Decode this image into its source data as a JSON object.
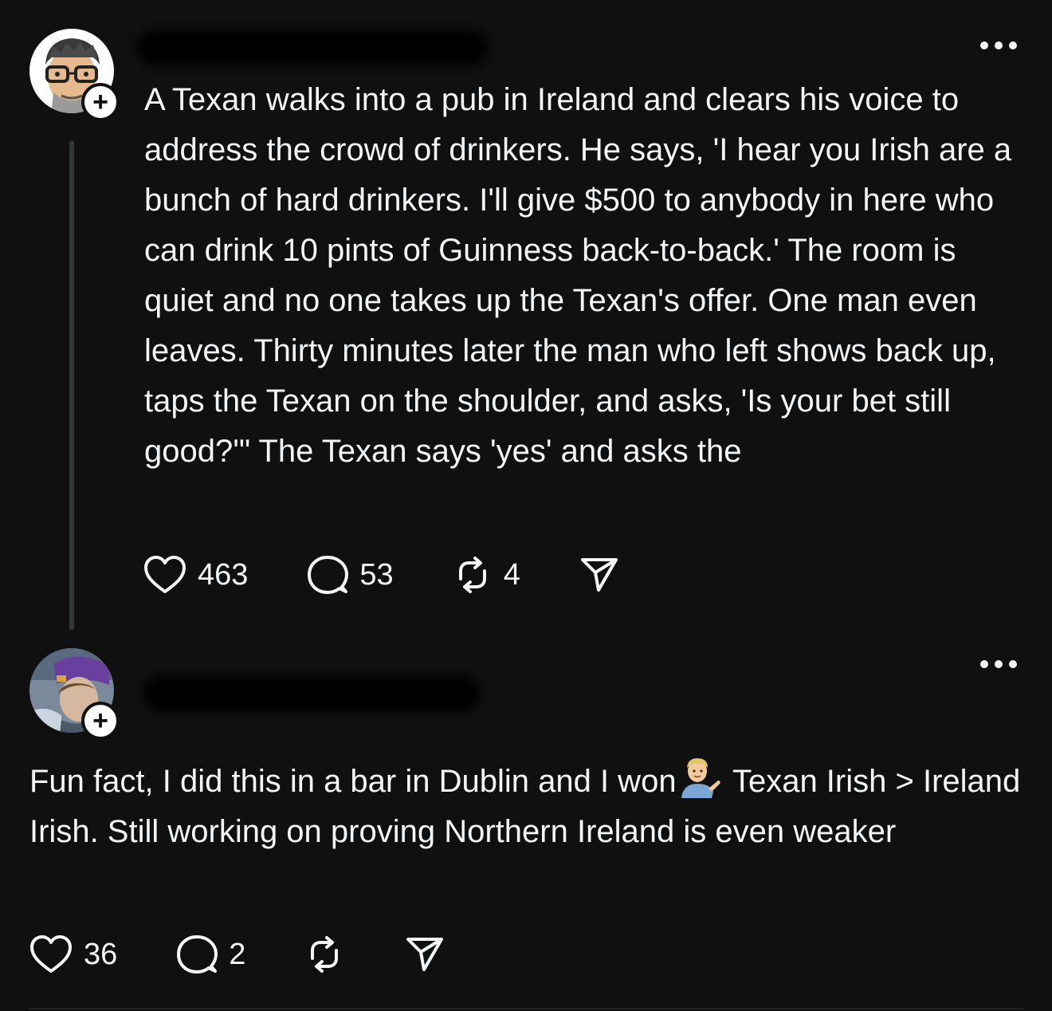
{
  "posts": [
    {
      "text": "A Texan walks into a pub in Ireland and clears his voice to address the crowd of drinkers. He says, 'I hear you Irish are a bunch of hard drinkers. I'll give $500 to anybody in here who can drink 10 pints of Guinness back-to-back.' The room is quiet and no one takes up the Texan's offer. One man even leaves. Thirty minutes later the man who left shows back up, taps the Texan on the shoulder, and asks, 'Is your bet still good?'\" The Texan says 'yes' and asks the",
      "likes": "463",
      "replies": "53",
      "reposts": "4"
    },
    {
      "text_part1": "Fun fact, I did this in a bar in Dublin and I won",
      "text_part2": " Texan Irish > Ireland Irish. Still working on proving Northern Ireland is even weaker",
      "emoji_icon": "person-tipping-hand-emoji",
      "likes": "36",
      "replies": "2",
      "reposts": ""
    }
  ],
  "follow_label": "+",
  "colors": {
    "background": "#101010",
    "text": "#f3f5f7",
    "thread_line": "#333638"
  }
}
